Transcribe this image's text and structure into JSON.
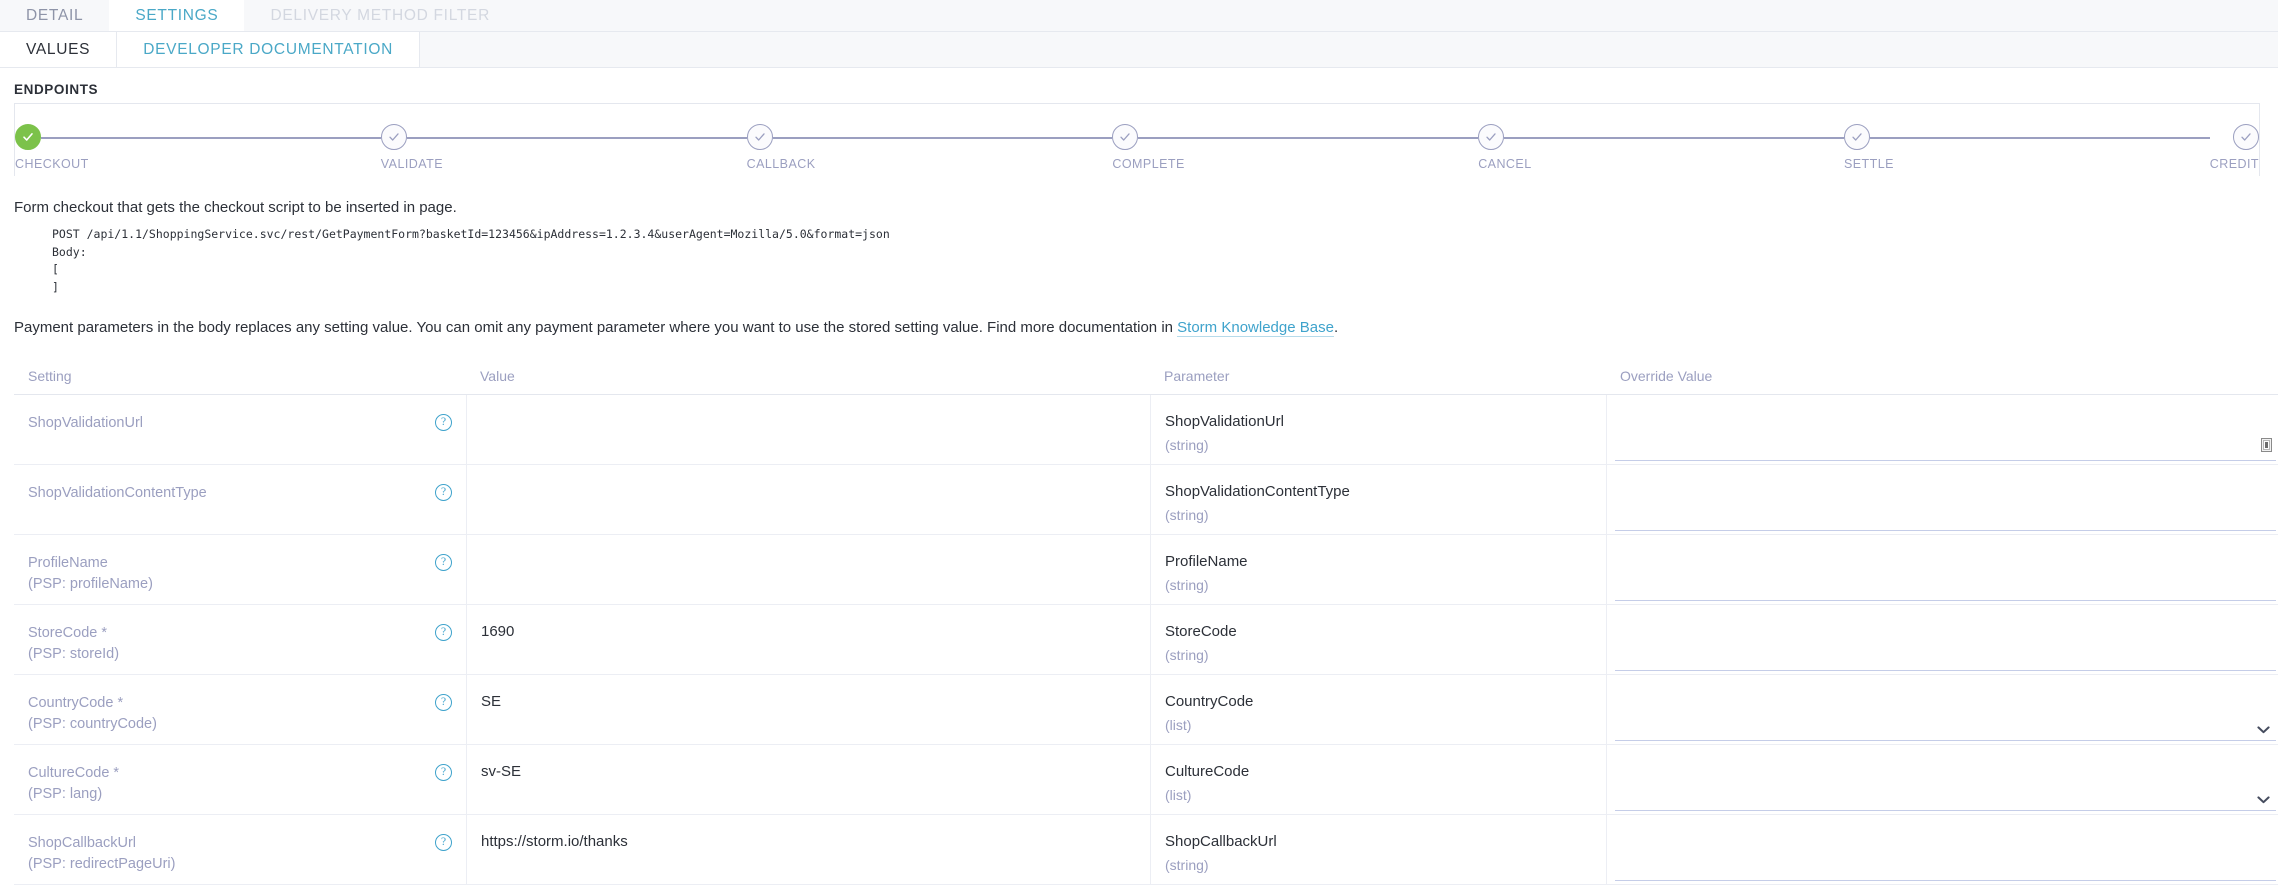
{
  "outer_tabs": [
    {
      "label": "DETAIL",
      "state": "normal"
    },
    {
      "label": "SETTINGS",
      "state": "active"
    },
    {
      "label": "DELIVERY METHOD FILTER",
      "state": "disabled"
    }
  ],
  "inner_tabs": [
    {
      "label": "VALUES",
      "state": "normal"
    },
    {
      "label": "DEVELOPER DOCUMENTATION",
      "state": "active"
    }
  ],
  "endpoints": {
    "section_label": "ENDPOINTS",
    "steps": [
      {
        "label": "CHECKOUT",
        "state": "done"
      },
      {
        "label": "VALIDATE",
        "state": "pending"
      },
      {
        "label": "CALLBACK",
        "state": "pending"
      },
      {
        "label": "COMPLETE",
        "state": "pending"
      },
      {
        "label": "CANCEL",
        "state": "pending"
      },
      {
        "label": "SETTLE",
        "state": "pending"
      },
      {
        "label": "CREDIT",
        "state": "pending"
      }
    ],
    "active_step_color": "#7cc24a",
    "pending_step_color": "#9b9fc0"
  },
  "doc": {
    "intro": "Form checkout that gets the checkout script to be inserted in page.",
    "code": "POST /api/1.1/ShoppingService.svc/rest/GetPaymentForm?basketId=123456&ipAddress=1.2.3.4&userAgent=Mozilla/5.0&format=json\nBody:\n[\n]",
    "note_before_link": "Payment parameters in the body replaces any setting value. You can omit any payment parameter where you want to use the stored setting value. Find more documentation in ",
    "note_link": "Storm Knowledge Base",
    "note_after_link": "."
  },
  "table": {
    "headers": [
      "Setting",
      "Value",
      "Parameter",
      "Override Value"
    ],
    "rows": [
      {
        "setting": "ShopValidationUrl",
        "setting_psp": "",
        "help": "?",
        "value": "",
        "parameter": "ShopValidationUrl",
        "param_type": "(string)",
        "override_value": "",
        "override_control": "text-resize"
      },
      {
        "setting": "ShopValidationContentType",
        "setting_psp": "",
        "help": "?",
        "value": "",
        "parameter": "ShopValidationContentType",
        "param_type": "(string)",
        "override_value": "",
        "override_control": "text"
      },
      {
        "setting": "ProfileName",
        "setting_psp": "(PSP: profileName)",
        "help": "?",
        "value": "",
        "parameter": "ProfileName",
        "param_type": "(string)",
        "override_value": "",
        "override_control": "text"
      },
      {
        "setting": "StoreCode *",
        "setting_psp": "(PSP: storeId)",
        "help": "?",
        "value": "1690",
        "parameter": "StoreCode",
        "param_type": "(string)",
        "override_value": "",
        "override_control": "text"
      },
      {
        "setting": "CountryCode *",
        "setting_psp": "(PSP: countryCode)",
        "help": "?",
        "value": "SE",
        "parameter": "CountryCode",
        "param_type": "(list)",
        "override_value": "",
        "override_control": "select"
      },
      {
        "setting": "CultureCode *",
        "setting_psp": "(PSP: lang)",
        "help": "?",
        "value": "sv-SE",
        "parameter": "CultureCode",
        "param_type": "(list)",
        "override_value": "",
        "override_control": "select"
      },
      {
        "setting": "ShopCallbackUrl",
        "setting_psp": "(PSP: redirectPageUri)",
        "help": "?",
        "value": "https://storm.io/thanks",
        "parameter": "ShopCallbackUrl",
        "param_type": "(string)",
        "override_value": "",
        "override_control": "text"
      }
    ]
  }
}
